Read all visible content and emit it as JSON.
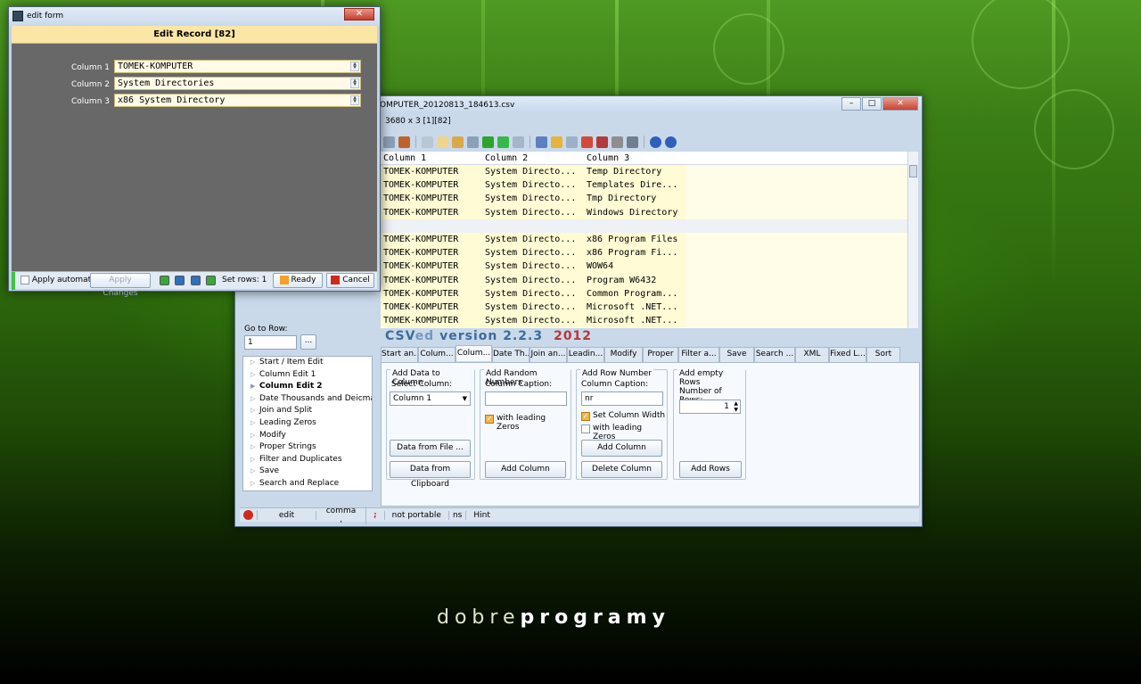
{
  "branding": {
    "light": "dobre",
    "bold": "programy"
  },
  "main_window": {
    "title": "OMPUTER_20120813_184613.csv",
    "record_info": "3680 x 3 [1][82]",
    "grid": {
      "columns": [
        "Column 1",
        "Column 2",
        "Column 3"
      ],
      "rows": [
        [
          "TOMEK-KOMPUTER",
          "System Directo...",
          "Temp Directory"
        ],
        [
          "TOMEK-KOMPUTER",
          "System Directo...",
          "Templates Dire..."
        ],
        [
          "TOMEK-KOMPUTER",
          "System Directo...",
          "Tmp Directory"
        ],
        [
          "TOMEK-KOMPUTER",
          "System Directo...",
          "Windows Directory"
        ],
        [
          "",
          "",
          ""
        ],
        [
          "TOMEK-KOMPUTER",
          "System Directo...",
          "x86 Program Files"
        ],
        [
          "TOMEK-KOMPUTER",
          "System Directo...",
          "x86 Program Fi..."
        ],
        [
          "TOMEK-KOMPUTER",
          "System Directo...",
          "WOW64"
        ],
        [
          "TOMEK-KOMPUTER",
          "System Directo...",
          "Program W6432"
        ],
        [
          "TOMEK-KOMPUTER",
          "System Directo...",
          "Common Program..."
        ],
        [
          "TOMEK-KOMPUTER",
          "System Directo...",
          "Microsoft .NET..."
        ],
        [
          "TOMEK-KOMPUTER",
          "System Directo...",
          "Microsoft .NET..."
        ]
      ]
    },
    "version": {
      "csv": "CSV",
      "ed": "ed",
      "ver": " version 2.2.3",
      "year": "2012"
    },
    "tabs": [
      "Start an...",
      "Colum...",
      "Colum...",
      "Date Th...",
      "Join an...",
      "Leadin...",
      "Modify",
      "Proper",
      "Filter a...",
      "Save",
      "Search ...",
      "XML",
      "Fixed L...",
      "Sort"
    ],
    "goto": {
      "label": "Go to Row:",
      "value": "1",
      "button": "..."
    },
    "side_list": [
      {
        "label": "Start / Item Edit",
        "bold": false
      },
      {
        "label": "Column Edit 1",
        "bold": false
      },
      {
        "label": "Column Edit 2",
        "bold": true
      },
      {
        "label": "Date Thousands and Deicmal",
        "bold": false
      },
      {
        "label": "Join and Split",
        "bold": false
      },
      {
        "label": "Leading Zeros",
        "bold": false
      },
      {
        "label": "Modify",
        "bold": false
      },
      {
        "label": "Proper Strings",
        "bold": false
      },
      {
        "label": "Filter and Duplicates",
        "bold": false
      },
      {
        "label": "Save",
        "bold": false
      },
      {
        "label": "Search and Replace",
        "bold": false
      }
    ],
    "panel": {
      "add_data": {
        "title": "Add Data to Column",
        "select_label": "Select Column:",
        "select_value": "Column 1",
        "btn_file": "Data from File ...",
        "btn_clip": "Data from Clipboard"
      },
      "random": {
        "title": "Add Random Numbers",
        "caption_label": "Column Caption:",
        "caption_value": "",
        "check_label": "with leading Zeros",
        "btn": "Add Column"
      },
      "rownum": {
        "title": "Add Row Number",
        "caption_label": "Column Caption:",
        "caption_value": "nr",
        "check1": "Set Column Width",
        "check2": "with leading Zeros",
        "btn_add": "Add Column",
        "btn_del": "Delete Column"
      },
      "empty": {
        "title": "Add empty Rows",
        "num_label": "Number of Rows:",
        "num_value": "1",
        "btn": "Add Rows"
      }
    },
    "status": [
      "edit",
      "comma ,",
      ";",
      "not portable",
      "ns",
      "Hint"
    ]
  },
  "edit_form": {
    "title": "edit form",
    "header": "Edit Record [82]",
    "fields": [
      {
        "label": "Column 1",
        "value": "TOMEK-KOMPUTER"
      },
      {
        "label": "Column 2",
        "value": "System Directories"
      },
      {
        "label": "Column 3",
        "value": "x86 System Directory"
      }
    ],
    "footer": {
      "apply_auto": "Apply automatic",
      "apply_changes": "Apply Changes",
      "set_rows": "Set rows: 1",
      "ready": "Ready",
      "cancel": "Cancel"
    }
  }
}
